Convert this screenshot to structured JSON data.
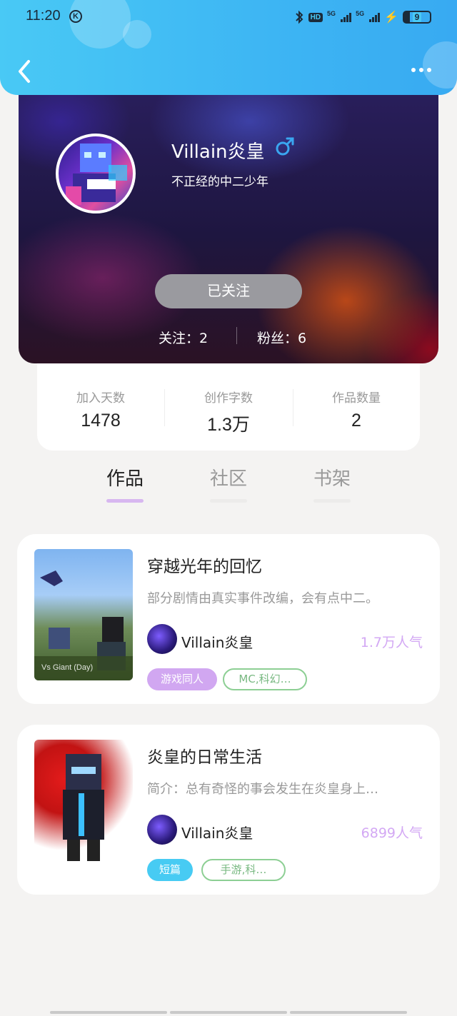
{
  "status_bar": {
    "time": "11:20",
    "k_badge": "K",
    "hd_label": "HD",
    "net1": "5G",
    "net2": "5G",
    "battery": "9"
  },
  "header": {
    "back_icon": "chevron-left-icon",
    "more_icon": "more-dots-icon",
    "bg_color": "#42BDF4"
  },
  "profile": {
    "username": "Villain炎皇",
    "gender_icon": "male-symbol-icon",
    "gender_color": "#3AA6F0",
    "bio": "不正经的中二少年",
    "follow_button": "已关注",
    "following": "关注：2",
    "fans": "粉丝：6"
  },
  "metrics": [
    {
      "label": "加入天数",
      "value": "1478"
    },
    {
      "label": "创作字数",
      "value": "1.3万"
    },
    {
      "label": "作品数量",
      "value": "2"
    }
  ],
  "tabs": [
    {
      "label": "作品",
      "active": true
    },
    {
      "label": "社区",
      "active": false
    },
    {
      "label": "书架",
      "active": false
    }
  ],
  "works": [
    {
      "title": "穿越光年的回忆",
      "description": "部分剧情由真实事件改编，会有点中二。",
      "cover_label": "Vs Giant (Day)",
      "author": "Villain炎皇",
      "popularity": "1.7万人气",
      "tags": [
        "游戏同人",
        "MC,科幻…"
      ]
    },
    {
      "title": "炎皇的日常生活",
      "description": "简介：总有奇怪的事会发生在炎皇身上…",
      "author": "Villain炎皇",
      "popularity": "6899人气",
      "tags": [
        "短篇",
        "手游,科…"
      ]
    }
  ],
  "colors": {
    "accent_purple": "#D1A7F1",
    "accent_blue": "#47CBF3",
    "tag_green": "#8DCF94"
  }
}
